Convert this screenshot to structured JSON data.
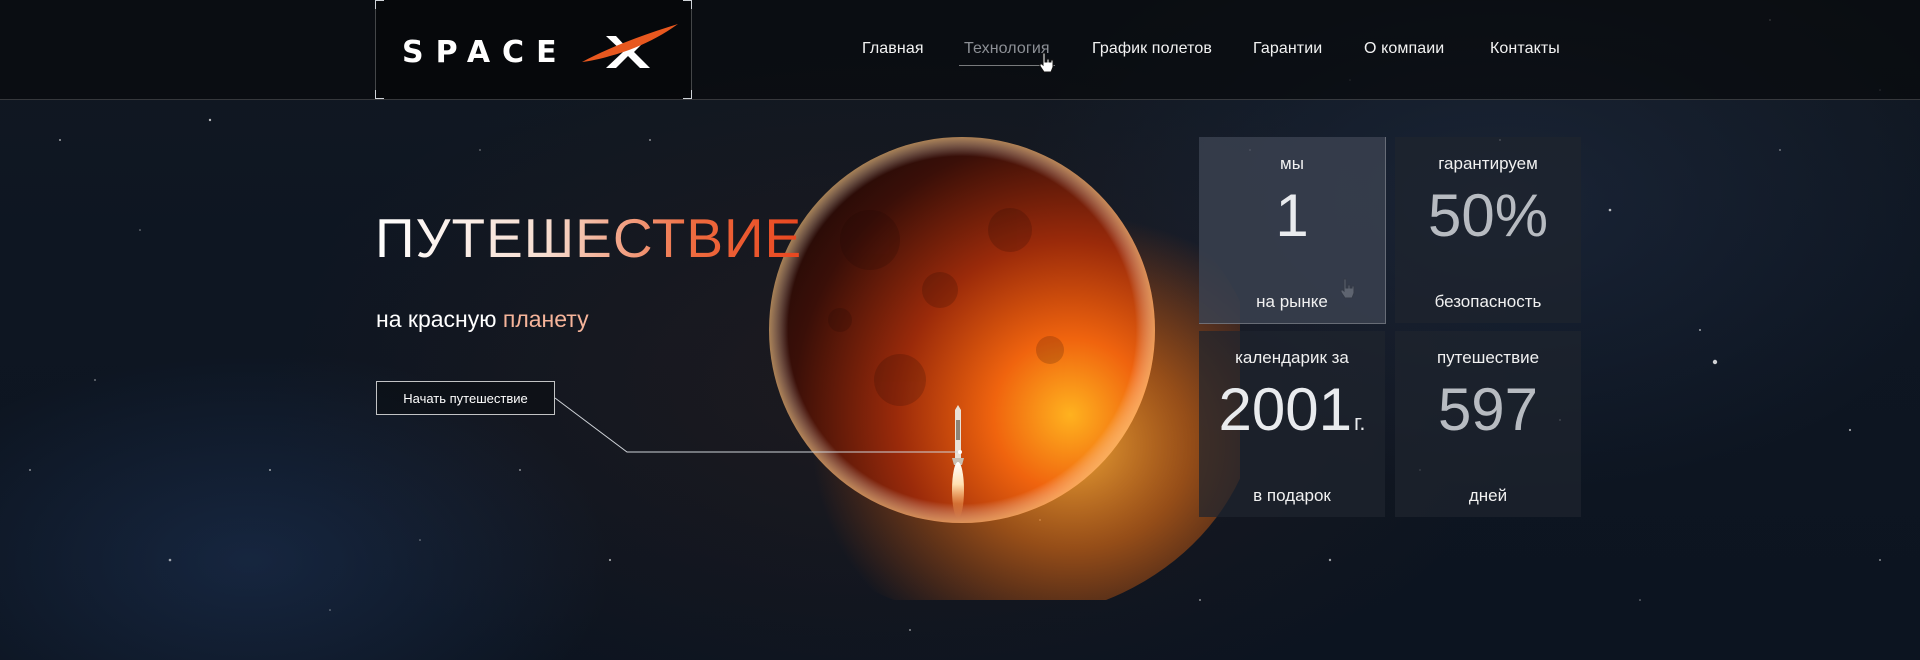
{
  "brand": {
    "logo_text": "SPACEX",
    "accent_color": "#e8581f"
  },
  "nav": {
    "items": [
      {
        "label": "Главная",
        "active": false
      },
      {
        "label": "Технология",
        "active": true
      },
      {
        "label": "График полетов",
        "active": false
      },
      {
        "label": "Гарантии",
        "active": false
      },
      {
        "label": "О компаии",
        "active": false
      },
      {
        "label": "Контакты",
        "active": false
      }
    ]
  },
  "hero": {
    "title": "ПУТЕШЕСТВИЕ",
    "subtitle_plain": "на красную ",
    "subtitle_accent": "планету",
    "cta_label": "Начать путешествие"
  },
  "stats": [
    {
      "top": "мы",
      "value": "1",
      "suffix": "",
      "bottom": "на рынке",
      "highlight": true
    },
    {
      "top": "гарантируем",
      "value": "50%",
      "suffix": "",
      "bottom": "безопасность",
      "highlight": false
    },
    {
      "top": "календарик за",
      "value": "2001",
      "suffix": "г.",
      "bottom": "в подарок",
      "highlight": false
    },
    {
      "top": "путешествие",
      "value": "597",
      "suffix": "",
      "bottom": "дней",
      "highlight": false
    }
  ],
  "icons": {
    "cursor": "hand-pointer-icon",
    "rocket": "rocket-icon",
    "planet": "mars-planet"
  }
}
